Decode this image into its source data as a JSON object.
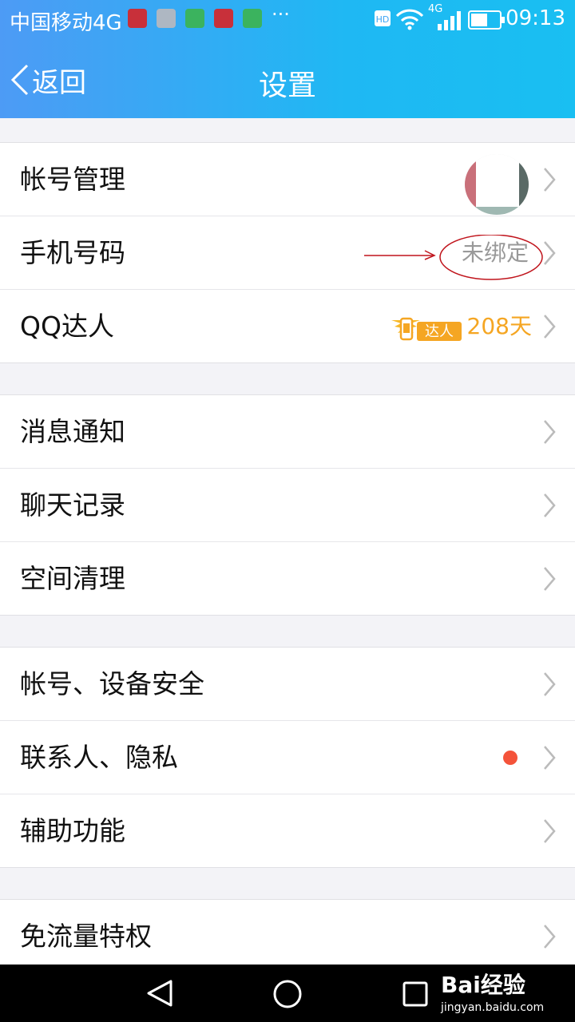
{
  "status_bar": {
    "carrier": "中国移动4G",
    "time": "09:13",
    "network_badge": "4G",
    "hd_badge": "HD",
    "more": "···"
  },
  "header": {
    "back_label": "返回",
    "title": "设置"
  },
  "groups": [
    {
      "rows": [
        {
          "label": "帐号管理",
          "trailing": "avatar"
        },
        {
          "label": "手机号码",
          "value": "未绑定"
        },
        {
          "label": "QQ达人",
          "badge": "达人",
          "value": "208天"
        }
      ]
    },
    {
      "rows": [
        {
          "label": "消息通知"
        },
        {
          "label": "聊天记录"
        },
        {
          "label": "空间清理"
        }
      ]
    },
    {
      "rows": [
        {
          "label": "帐号、设备安全"
        },
        {
          "label": "联系人、隐私",
          "trailing": "red-dot"
        },
        {
          "label": "辅助功能"
        }
      ]
    },
    {
      "rows": [
        {
          "label": "免流量特权"
        }
      ]
    }
  ],
  "watermark": {
    "brand": "Bai经验",
    "url": "jingyan.baidu.com"
  },
  "colors": {
    "header_start": "#4d9bf5",
    "header_end": "#19bff2",
    "accent_orange": "#f5a623",
    "red_dot": "#f4533a",
    "annotation_red": "#c0141c"
  }
}
